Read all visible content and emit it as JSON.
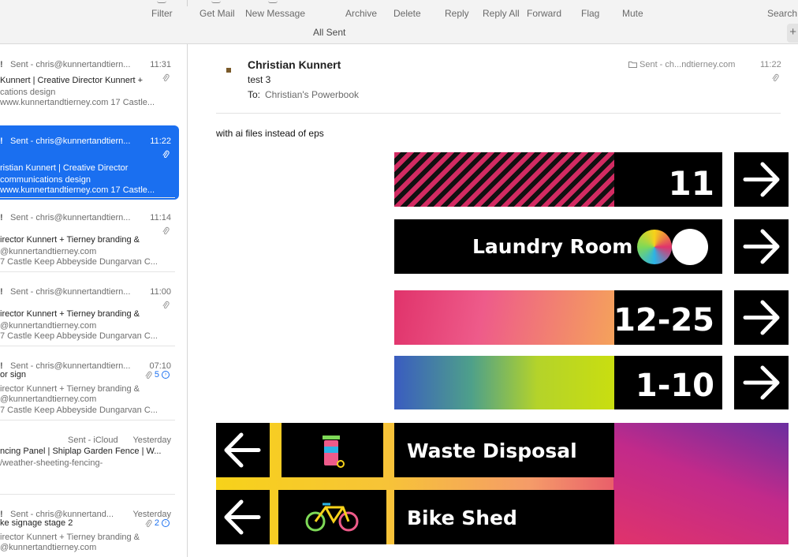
{
  "toolbar": {
    "filter": "Filter",
    "get_mail": "Get Mail",
    "new_message": "New Message",
    "archive": "Archive",
    "delete": "Delete",
    "reply": "Reply",
    "reply_all": "Reply All",
    "forward": "Forward",
    "flag": "Flag",
    "mute": "Mute",
    "search": "Search",
    "mailbox_title": "All Sent",
    "plus": "+"
  },
  "messages": [
    {
      "sender": "Sent - chris@kunnertandtiern...",
      "time": "11:31",
      "subject": "Kunnert | Creative Director Kunnert +",
      "preview": "cations design",
      "preview2": "www.kunnertandtierney.com 17 Castle..."
    },
    {
      "sender": "Sent - chris@kunnertandtiern...",
      "time": "11:22",
      "subject": "ristian Kunnert | Creative Director",
      "preview": " communications design",
      "preview2": "www.kunnertandtierney.com 17 Castle..."
    },
    {
      "sender": "Sent - chris@kunnertandtiern...",
      "time": "11:14",
      "subject": "irector Kunnert + Tierney branding &",
      "preview": "@kunnertandtierney.com",
      "preview2": "7 Castle Keep Abbeyside Dungarvan C..."
    },
    {
      "sender": "Sent - chris@kunnertandtiern...",
      "time": "11:00",
      "subject": "irector Kunnert + Tierney branding &",
      "preview": "@kunnertandtierney.com",
      "preview2": "7 Castle Keep Abbeyside Dungarvan C..."
    },
    {
      "sender": "Sent - chris@kunnertandtiern...",
      "time": "07:10",
      "subject": "or sign",
      "count": "5",
      "preview": "irector Kunnert + Tierney branding &",
      "preview2": "@kunnertandtierney.com",
      "preview3": "7 Castle Keep Abbeyside Dungarvan C..."
    },
    {
      "sender": "Sent - iCloud",
      "time": "Yesterday",
      "subject": "ncing Panel | Shiplap Garden Fence | W...",
      "preview": "/weather-sheeting-fencing-"
    },
    {
      "sender": "Sent - chris@kunnertand...",
      "time": "Yesterday",
      "subject": "ke signage stage 2",
      "count": "2",
      "preview": "irector Kunnert + Tierney branding &",
      "preview2": "@kunnertandtierney.com"
    }
  ],
  "reader": {
    "from": "Christian Kunnert",
    "subject": "test 3",
    "to_label": "To:",
    "to": "Christian's Powerbook",
    "mailbox": "Sent - ch...ndtierney.com",
    "time": "11:22",
    "body": "with ai files instead of eps"
  },
  "signs": {
    "number_1": "11",
    "laundry": "Laundry Room",
    "range_1": "12-25",
    "range_2": "1-10",
    "waste": "Waste Disposal",
    "bike": "Bike Shed"
  },
  "colors": {
    "accent": "#1a6ff0",
    "sign_black": "#000000",
    "sign_pink": "#e0336b",
    "sign_yellow": "#f7d21a"
  },
  "icons": {
    "attachment": "paperclip-icon",
    "folder": "folder-icon",
    "arrow_right": "arrow-right-icon",
    "arrow_left": "arrow-left-icon",
    "bin": "recycling-bin-icon",
    "bike": "bicycle-icon"
  }
}
